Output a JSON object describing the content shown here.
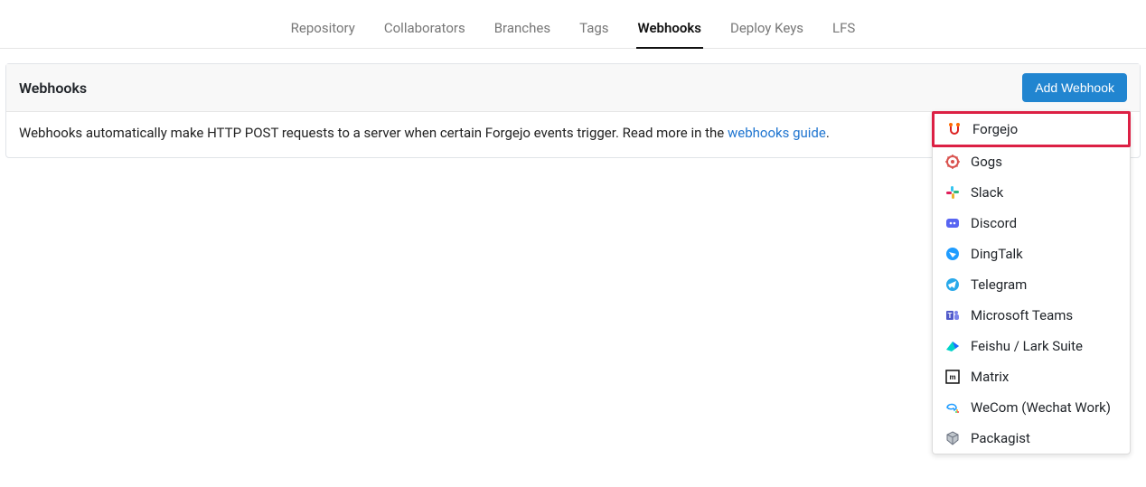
{
  "tabs": {
    "items": [
      {
        "label": "Repository",
        "active": false
      },
      {
        "label": "Collaborators",
        "active": false
      },
      {
        "label": "Branches",
        "active": false
      },
      {
        "label": "Tags",
        "active": false
      },
      {
        "label": "Webhooks",
        "active": true
      },
      {
        "label": "Deploy Keys",
        "active": false
      },
      {
        "label": "LFS",
        "active": false
      }
    ]
  },
  "panel": {
    "title": "Webhooks",
    "add_button": "Add Webhook",
    "body_prefix": "Webhooks automatically make HTTP POST requests to a server when certain Forgejo events trigger. Read more in the ",
    "body_link": "webhooks guide",
    "body_suffix": "."
  },
  "dropdown": {
    "items": [
      {
        "label": "Forgejo",
        "icon": "forgejo-icon",
        "highlight": true
      },
      {
        "label": "Gogs",
        "icon": "gogs-icon",
        "highlight": false
      },
      {
        "label": "Slack",
        "icon": "slack-icon",
        "highlight": false
      },
      {
        "label": "Discord",
        "icon": "discord-icon",
        "highlight": false
      },
      {
        "label": "DingTalk",
        "icon": "dingtalk-icon",
        "highlight": false
      },
      {
        "label": "Telegram",
        "icon": "telegram-icon",
        "highlight": false
      },
      {
        "label": "Microsoft Teams",
        "icon": "msteams-icon",
        "highlight": false
      },
      {
        "label": "Feishu / Lark Suite",
        "icon": "feishu-icon",
        "highlight": false
      },
      {
        "label": "Matrix",
        "icon": "matrix-icon",
        "highlight": false
      },
      {
        "label": "WeCom (Wechat Work)",
        "icon": "wecom-icon",
        "highlight": false
      },
      {
        "label": "Packagist",
        "icon": "packagist-icon",
        "highlight": false
      }
    ]
  }
}
